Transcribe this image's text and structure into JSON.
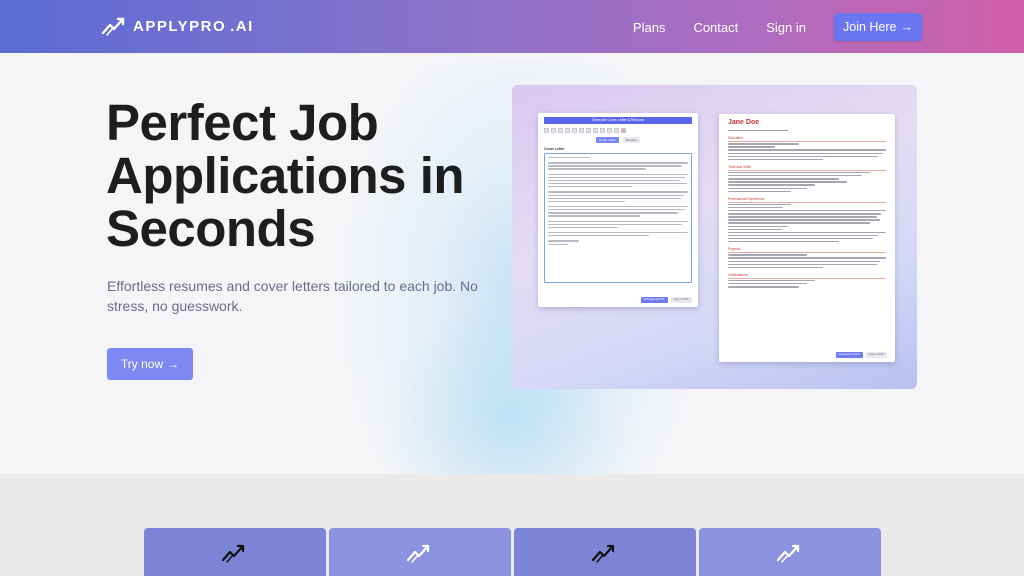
{
  "header": {
    "logo_text": "APPLYPRO.AI",
    "logo_main": "APPLYPRO",
    "logo_ai": ".AI",
    "nav": [
      {
        "label": "Plans"
      },
      {
        "label": "Contact"
      },
      {
        "label": "Sign in"
      }
    ],
    "join_label": "Join Here",
    "join_arrow": "→"
  },
  "hero": {
    "title": "Perfect Job Applications in Seconds",
    "subtitle": "Effortless resumes and cover letters tailored to each job. No stress, no guesswork.",
    "cta_label": "Try now",
    "cta_arrow": "→"
  },
  "preview": {
    "cover_letter": {
      "header": "Generate Cover Letter & Resume",
      "tab_primary": "Cover Letter",
      "tab_secondary": "Resume",
      "label": "Cover Letter",
      "btn_primary": "Download as PDF",
      "btn_secondary": "Copy to DOC"
    },
    "resume": {
      "name": "Jane Doe",
      "sections": [
        "Education",
        "Technical Skills",
        "Professional Experience",
        "Projects",
        "Certifications"
      ],
      "btn_primary": "Download as PDF",
      "btn_secondary": "Copy to DOC"
    }
  },
  "feature_cards": [
    {
      "icon": "trend-logo-icon"
    },
    {
      "icon": "trend-logo-icon"
    },
    {
      "icon": "trend-logo-icon"
    },
    {
      "icon": "trend-logo-icon"
    }
  ],
  "colors": {
    "header_gradient_start": "#5b6cd4",
    "header_gradient_end": "#d05ea8",
    "accent": "#7e88f2",
    "title": "#1e1e1e",
    "subtitle": "#6b6b90"
  }
}
